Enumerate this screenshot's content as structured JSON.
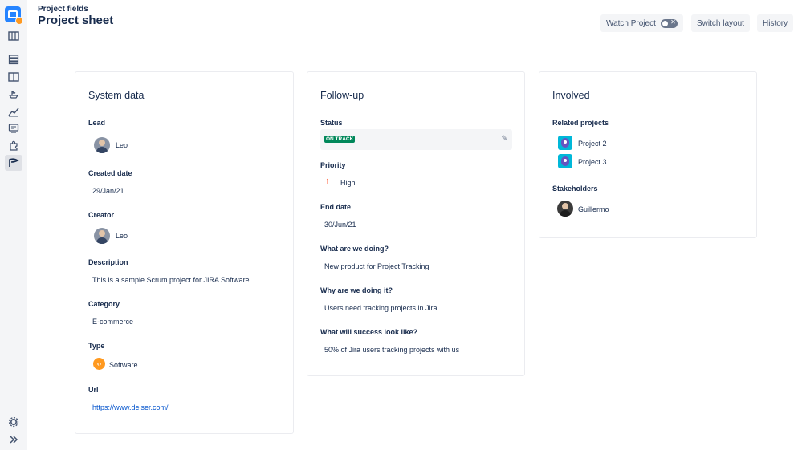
{
  "header": {
    "breadcrumb": "Project fields",
    "title": "Project sheet",
    "watch_label": "Watch Project",
    "watch_enabled": false,
    "switch_layout_label": "Switch layout",
    "history_label": "History"
  },
  "sidebar": {
    "icons": [
      "app-logo-icon",
      "board-icon",
      "backlog-icon",
      "columns-icon",
      "ship-icon",
      "reports-icon",
      "board-view-icon",
      "puzzle-icon",
      "project-sheet-icon",
      "settings-icon",
      "expand-icon"
    ],
    "active": "project-sheet-icon"
  },
  "system": {
    "title": "System data",
    "lead_label": "Lead",
    "lead": "Leo",
    "created_label": "Created date",
    "created": "29/Jan/21",
    "creator_label": "Creator",
    "creator": "Leo",
    "description_label": "Description",
    "description": "This is a sample Scrum project for JIRA Software.",
    "category_label": "Category",
    "category": "E-commerce",
    "type_label": "Type",
    "type": "Software",
    "url_label": "Url",
    "url": "https://www.deiser.com/"
  },
  "followup": {
    "title": "Follow-up",
    "status_label": "Status",
    "status": "ON TRACK",
    "priority_label": "Priority",
    "priority": "High",
    "end_label": "End date",
    "end": "30/Jun/21",
    "what_label": "What are we doing?",
    "what": "New product for Project Tracking",
    "why_label": "Why are we doing it?",
    "why": "Users need tracking projects in Jira",
    "success_label": "What will success look like?",
    "success": "50% of Jira users tracking projects with us"
  },
  "involved": {
    "title": "Involved",
    "related_label": "Related projects",
    "projects": [
      "Project 2",
      "Project 3"
    ],
    "stakeholders_label": "Stakeholders",
    "stakeholder": "Guillermo"
  },
  "colors": {
    "accent": "#0052cc",
    "status_green": "#00875a",
    "priority_high": "#ff5630",
    "type_orange": "#ff991f"
  }
}
